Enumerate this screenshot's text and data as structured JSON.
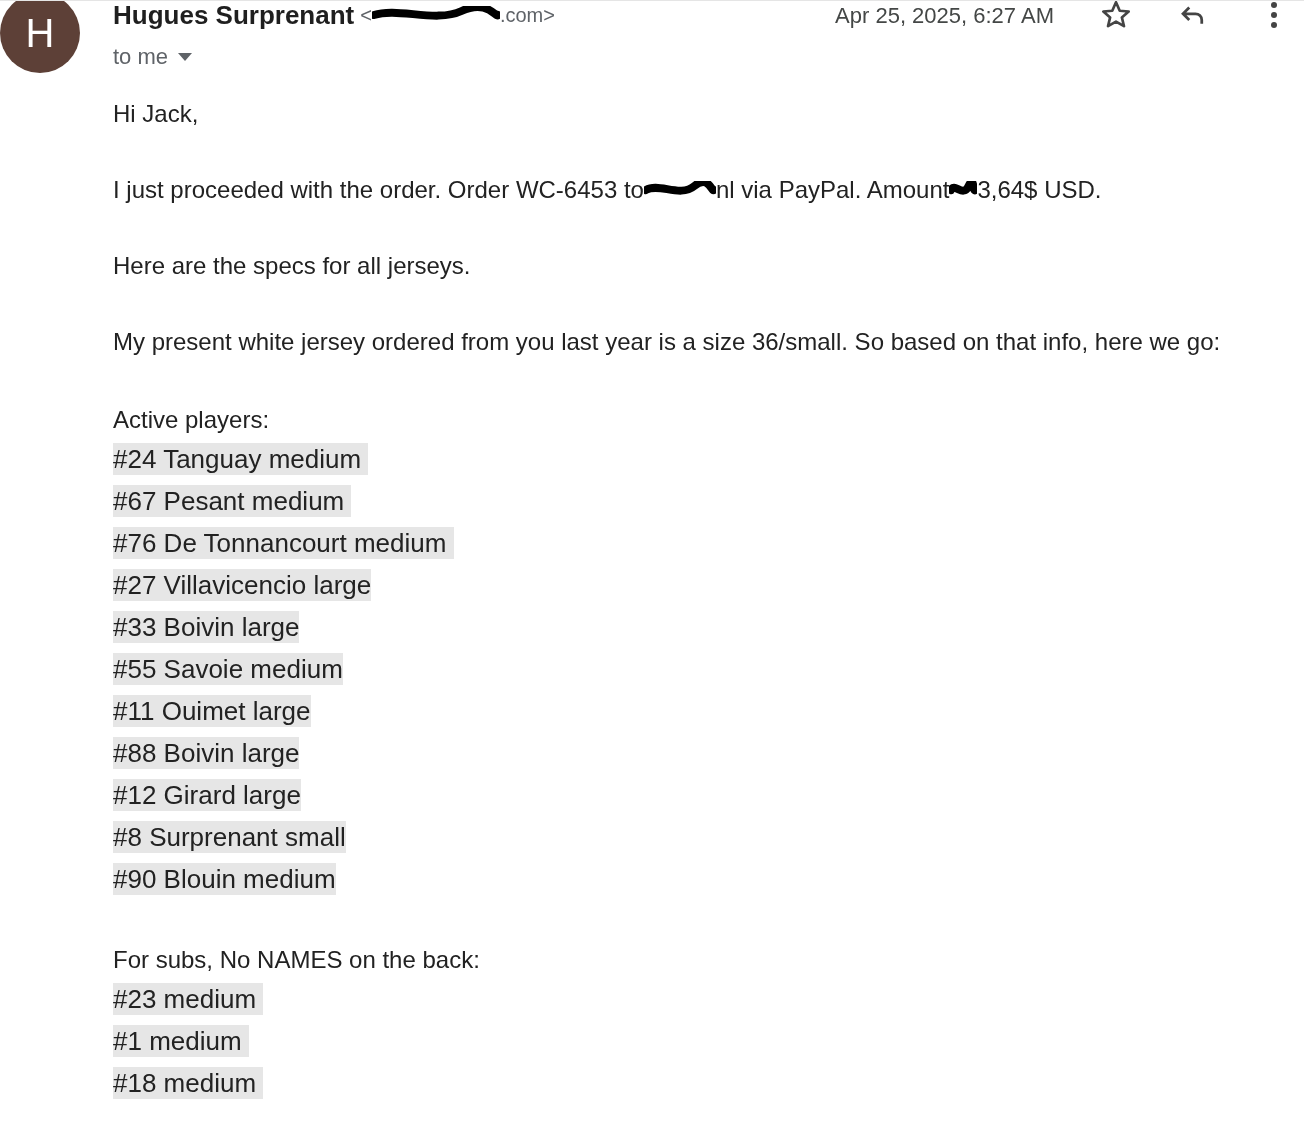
{
  "sender": {
    "avatar_letter": "H",
    "name": "Hugues Surprenant",
    "email_start": "<",
    "email_end": ".com>",
    "recipient": "to me",
    "date": "Apr 25, 2025, 6:27 AM",
    "starred": false
  },
  "body": {
    "greeting": "Hi Jack,",
    "order_line": [
      "I just proceeded with the order. Order WC-6453 to",
      "nl via PayPal. Amount",
      "3,64$ USD."
    ],
    "paragraphs": [
      "Here are the specs for all jerseys.",
      "My present white jersey ordered from you last year is a size 36/small. So based on that info, here we go:"
    ],
    "sections": [
      {
        "heading": "Active players:",
        "items": [
          "#24 Tanguay medium ",
          "#67 Pesant medium ",
          "#76 De Tonnancourt medium ",
          "#27 Villavicencio large",
          "#33 Boivin large",
          "#55 Savoie medium",
          "#11 Ouimet large",
          "#88 Boivin large",
          "#12 Girard large",
          "#8 Surprenant small",
          "#90 Blouin medium"
        ]
      },
      {
        "heading": "For subs, No NAMES on the back:",
        "items": [
          "#23 medium ",
          "#1 medium ",
          "#18 medium "
        ]
      }
    ]
  }
}
